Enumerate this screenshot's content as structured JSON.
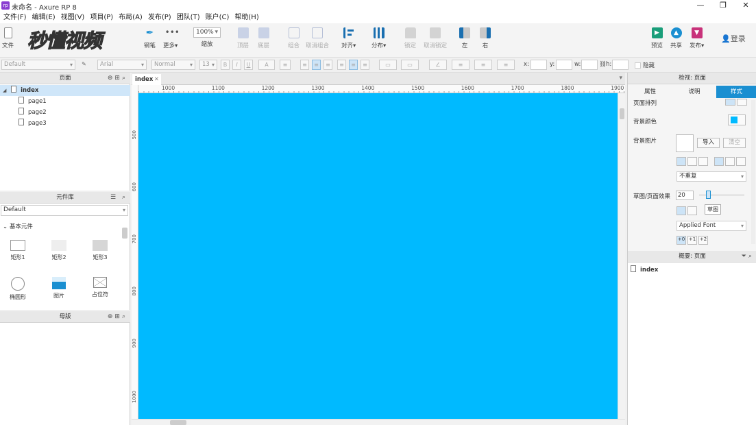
{
  "window": {
    "title": "未命名 - Axure RP 8",
    "app_icon": "rp"
  },
  "menu": [
    "文件(F)",
    "编辑(E)",
    "视图(V)",
    "项目(P)",
    "布局(A)",
    "发布(P)",
    "团队(T)",
    "账户(C)",
    "帮助(H)"
  ],
  "watermark": "秒懂视频",
  "toolbar": {
    "file": "文件",
    "pen": "钢笔",
    "more": "更多▾",
    "zoom_value": "100%",
    "zoom": "缩放",
    "top": "顶层",
    "bottom": "底层",
    "group": "组合",
    "ungroup": "取消组合",
    "align": "对齐▾",
    "distribute": "分布▾",
    "lock": "锁定",
    "unlock": "取消锁定",
    "left": "左",
    "right": "右",
    "preview": "预览",
    "share": "共享",
    "publish": "发布▾",
    "login": "登录",
    "accent": "#1a8fd1"
  },
  "format": {
    "style": "Default",
    "font": "Arial",
    "weight": "Normal",
    "size": "13",
    "x": "x:",
    "y": "y:",
    "w": "w:",
    "h": "h:",
    "hidden": "隐藏"
  },
  "pages": {
    "title": "页面",
    "items": [
      "index",
      "page1",
      "page2",
      "page3"
    ]
  },
  "library": {
    "title": "元件库",
    "selected": "Default",
    "group": "基本元件",
    "widgets": [
      "矩形1",
      "矩形2",
      "矩形3",
      "椭圆形",
      "图片",
      "占位符"
    ]
  },
  "masters": {
    "title": "母版"
  },
  "canvas": {
    "tab": "index",
    "color": "#00baff",
    "ruler_top": [
      "1000",
      "1100",
      "1200",
      "1300",
      "1400",
      "1500",
      "1600",
      "1700",
      "1800",
      "1900"
    ],
    "ruler_left": [
      "500",
      "600",
      "700",
      "800",
      "900",
      "1000"
    ]
  },
  "inspector": {
    "title": "检视: 页面",
    "tabs": [
      "属性",
      "说明",
      "样式"
    ],
    "page_align": "页面排列",
    "bg_color": "背景颜色",
    "bg_image": "背景图片",
    "import": "导入",
    "clear": "清空",
    "repeat": "不重复",
    "sketch": "草图/页面效果",
    "sketch_value": "20",
    "tooltip": "草图",
    "font": "Applied Font",
    "font_steps": [
      "+0",
      "+1",
      "+2"
    ]
  },
  "outline": {
    "title": "概要: 页面",
    "item": "index"
  }
}
